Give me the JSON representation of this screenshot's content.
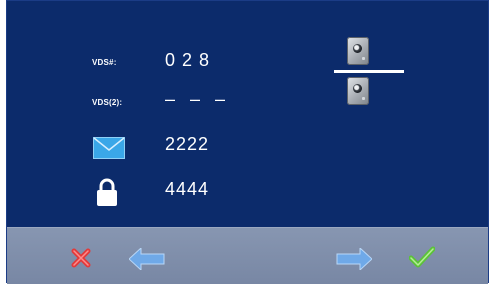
{
  "rows": [
    {
      "label": "VDS#:",
      "value": "0 2 8"
    },
    {
      "label": "VDS(2):",
      "value": "– – –"
    },
    {
      "icon": "envelope-icon",
      "value": "2222"
    },
    {
      "icon": "lock-icon",
      "value": "4444"
    }
  ],
  "devices": [
    {
      "icon": "door-station-icon"
    },
    {
      "icon": "door-station-icon"
    }
  ],
  "toolbar": {
    "cancel_icon": "cross-icon",
    "back_icon": "arrow-left-icon",
    "next_icon": "arrow-right-icon",
    "confirm_icon": "checkmark-icon"
  },
  "colors": {
    "background": "#0c2b6b",
    "toolbar": "#8193af",
    "envelope": "#3aa7e8",
    "cancel": "#e23a3a",
    "confirm": "#5cc23a",
    "arrow": "#6fa9e8"
  }
}
